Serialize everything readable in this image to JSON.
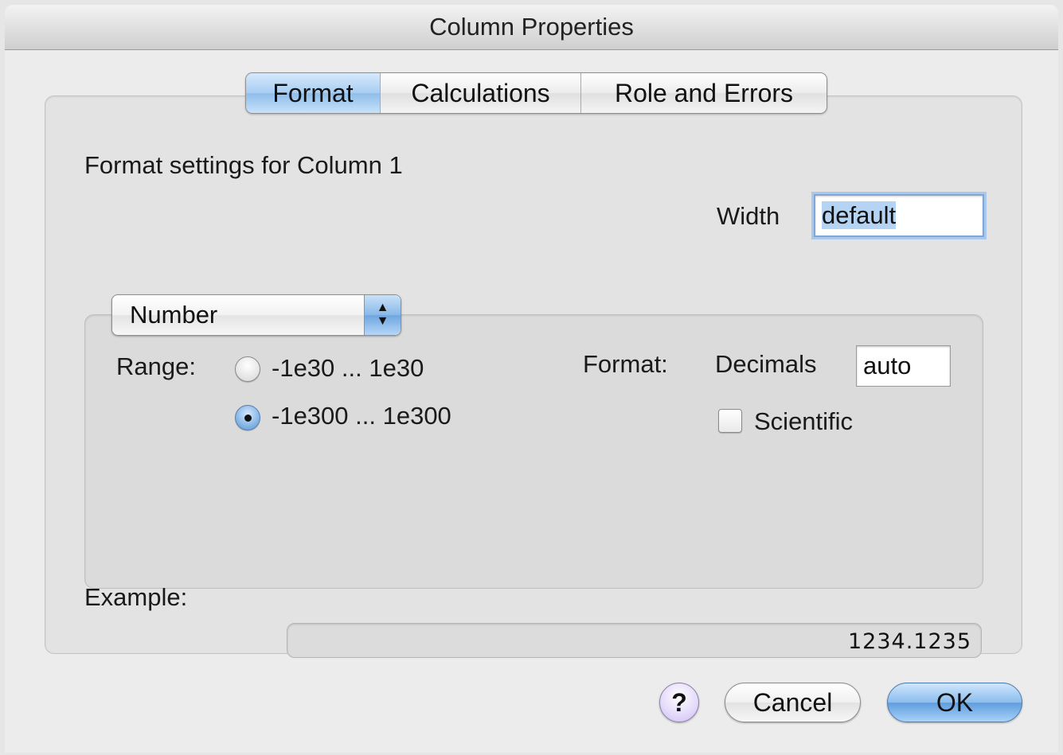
{
  "window": {
    "title": "Column Properties"
  },
  "tabs": [
    {
      "label": "Format",
      "active": true
    },
    {
      "label": "Calculations",
      "active": false
    },
    {
      "label": "Role and Errors",
      "active": false
    }
  ],
  "heading": "Format settings for Column 1",
  "width": {
    "label": "Width",
    "value": "default"
  },
  "type_popup": {
    "selected": "Number"
  },
  "range": {
    "label": "Range:",
    "options": [
      {
        "label": "-1e30 ... 1e30",
        "selected": false
      },
      {
        "label": "-1e300 ... 1e300",
        "selected": true
      }
    ]
  },
  "format": {
    "label": "Format:",
    "decimals_label": "Decimals",
    "decimals_value": "auto",
    "scientific_label": "Scientific",
    "scientific_checked": false
  },
  "example": {
    "label": "Example:",
    "value": "1234.1235"
  },
  "buttons": {
    "help": "?",
    "cancel": "Cancel",
    "ok": "OK"
  },
  "colors": {
    "accent": "#8fbde9",
    "default_button": "#5f9ddf",
    "help_button": "#cdbef2"
  }
}
